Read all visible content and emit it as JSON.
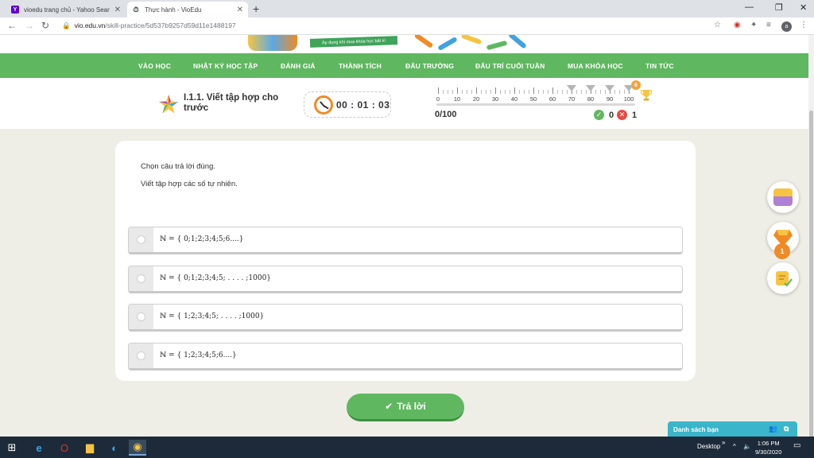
{
  "browser": {
    "tabs": [
      {
        "title": "vioedu trang chủ - Yahoo Search",
        "favicon": "yahoo-icon",
        "color": "#5f01d1"
      },
      {
        "title": "Thực hành - VioEdu",
        "favicon": "stopwatch-icon",
        "active": true
      }
    ],
    "url_host": "vio.edu.vn",
    "url_path": "/skill-practice/5d537b9257d59d11e1488197",
    "profile_initial": "a"
  },
  "banner": {
    "promo_text": "Áp dụng khi mua khóa học bất kì"
  },
  "nav": {
    "items": [
      "VÀO HỌC",
      "NHẬT KÝ HỌC TẬP",
      "ĐÁNH GIÁ",
      "THÀNH TÍCH",
      "ĐẤU TRƯỜNG",
      "ĐẤU TRÍ CUỐI TUẦN",
      "MUA KHÓA HỌC",
      "TIN TỨC"
    ],
    "color": "#5fb760"
  },
  "exercise": {
    "title": "I.1.1. Viết tập hợp cho trước",
    "timer": "00 : 01 : 03",
    "scale_labels": [
      "0",
      "10",
      "20",
      "30",
      "40",
      "50",
      "60",
      "70",
      "80",
      "90",
      "100"
    ],
    "milestone_markers": [
      70,
      80,
      90,
      100
    ],
    "streak_badge": "6",
    "score": "0/100",
    "correct_count": "0",
    "wrong_count": "1"
  },
  "question": {
    "instruction": "Chọn câu trả lời đúng.",
    "prompt": "Viết tập hợp các số tự nhiên.",
    "options": [
      "ℕ = { 0;1;2;3;4;5;6....}",
      "ℕ = { 0;1;2;3;4;5; . . . . ;1000}",
      "ℕ = { 1;2;3;4;5; . . . . ;1000}",
      "ℕ = { 1;2;3;4;5;6....}"
    ],
    "submit_label": "Trả lời"
  },
  "side": {
    "badge_count": "1",
    "friends_label": "Danh sách bạn"
  },
  "taskbar": {
    "desktop_label": "Desktop",
    "time": "1:06 PM",
    "date": "9/30/2020"
  }
}
